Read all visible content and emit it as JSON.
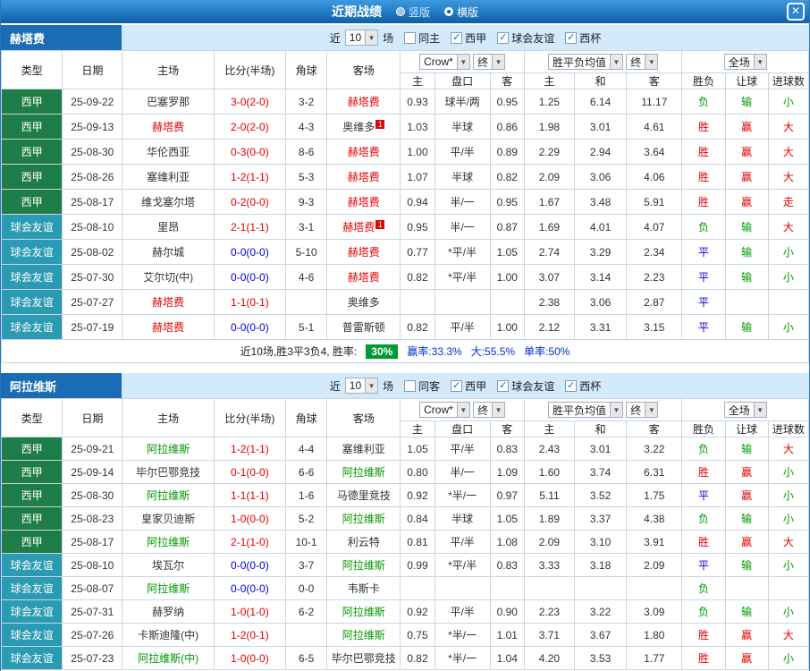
{
  "topbar": {
    "title": "近期战绩",
    "layouts": [
      {
        "label": "竖版",
        "selected": false
      },
      {
        "label": "横版",
        "selected": true
      }
    ],
    "close": "✕"
  },
  "colors": {
    "accent_blue": "#1a6cb4",
    "league_green_bg": "#1f7d48",
    "friendly_teal_bg": "#2b9bb3",
    "win_red": "#e60000",
    "loss_green": "#009900",
    "draw_blue": "#0000e0",
    "rate_badge_green": "#009933",
    "stat_blue": "#0033cc"
  },
  "table_labels": {
    "cols": [
      "类型",
      "日期",
      "主场",
      "比分(半场)",
      "角球",
      "客场"
    ],
    "book_dd": "Crow*",
    "final_dd": "终",
    "avg_dd": "胜平负均值",
    "final2_dd": "终",
    "scope_dd": "全场",
    "odds_sub": [
      "主",
      "盘口",
      "客"
    ],
    "avg_sub": [
      "主",
      "和",
      "客"
    ],
    "result_sub": [
      "胜负",
      "让球",
      "进球数"
    ]
  },
  "sections": [
    {
      "team": "赫塔费",
      "filter": {
        "recent": "近",
        "count": "10",
        "unit": "场",
        "checkboxes": [
          {
            "label": "同主",
            "checked": false
          },
          {
            "label": "西甲",
            "checked": true
          },
          {
            "label": "球会友谊",
            "checked": true
          },
          {
            "label": "西杯",
            "checked": true
          }
        ]
      },
      "rows": [
        {
          "league": "西甲",
          "lcls": "type-league",
          "date": "25-09-22",
          "home": {
            "name": "巴塞罗那",
            "cls": "",
            "badge": ""
          },
          "score": "3-0(2-0)",
          "scls": "red",
          "corners": "3-2",
          "away": {
            "name": "赫塔费",
            "cls": "t-red",
            "badge": ""
          },
          "odds": [
            "0.93",
            "球半/两",
            "0.95"
          ],
          "avg": [
            "1.25",
            "6.14",
            "11.17"
          ],
          "results": [
            [
              "负",
              "green"
            ],
            [
              "输",
              "green"
            ],
            [
              "小",
              "green"
            ]
          ]
        },
        {
          "league": "西甲",
          "lcls": "type-league",
          "date": "25-09-13",
          "home": {
            "name": "赫塔费",
            "cls": "t-red",
            "badge": ""
          },
          "score": "2-0(2-0)",
          "scls": "red",
          "corners": "4-3",
          "away": {
            "name": "奥维多",
            "cls": "",
            "badge": "1"
          },
          "odds": [
            "1.03",
            "半球",
            "0.86"
          ],
          "avg": [
            "1.98",
            "3.01",
            "4.61"
          ],
          "results": [
            [
              "胜",
              "red"
            ],
            [
              "赢",
              "red"
            ],
            [
              "大",
              "red"
            ]
          ]
        },
        {
          "league": "西甲",
          "lcls": "type-league",
          "date": "25-08-30",
          "home": {
            "name": "华伦西亚",
            "cls": "",
            "badge": ""
          },
          "score": "0-3(0-0)",
          "scls": "red",
          "corners": "8-6",
          "away": {
            "name": "赫塔费",
            "cls": "t-red",
            "badge": ""
          },
          "odds": [
            "1.00",
            "平/半",
            "0.89"
          ],
          "avg": [
            "2.29",
            "2.94",
            "3.64"
          ],
          "results": [
            [
              "胜",
              "red"
            ],
            [
              "赢",
              "red"
            ],
            [
              "大",
              "red"
            ]
          ]
        },
        {
          "league": "西甲",
          "lcls": "type-league",
          "date": "25-08-26",
          "home": {
            "name": "塞维利亚",
            "cls": "",
            "badge": ""
          },
          "score": "1-2(1-1)",
          "scls": "red",
          "corners": "5-3",
          "away": {
            "name": "赫塔费",
            "cls": "t-red",
            "badge": ""
          },
          "odds": [
            "1.07",
            "半球",
            "0.82"
          ],
          "avg": [
            "2.09",
            "3.06",
            "4.06"
          ],
          "results": [
            [
              "胜",
              "red"
            ],
            [
              "赢",
              "red"
            ],
            [
              "大",
              "red"
            ]
          ]
        },
        {
          "league": "西甲",
          "lcls": "type-league",
          "date": "25-08-17",
          "home": {
            "name": "维戈塞尔塔",
            "cls": "",
            "badge": ""
          },
          "score": "0-2(0-0)",
          "scls": "red",
          "corners": "9-3",
          "away": {
            "name": "赫塔费",
            "cls": "t-red",
            "badge": ""
          },
          "odds": [
            "0.94",
            "半/一",
            "0.95"
          ],
          "avg": [
            "1.67",
            "3.48",
            "5.91"
          ],
          "results": [
            [
              "胜",
              "red"
            ],
            [
              "赢",
              "red"
            ],
            [
              "走",
              "red"
            ]
          ]
        },
        {
          "league": "球会友谊",
          "lcls": "type-friendly",
          "date": "25-08-10",
          "home": {
            "name": "里昂",
            "cls": "",
            "badge": ""
          },
          "score": "2-1(1-1)",
          "scls": "red",
          "corners": "3-1",
          "away": {
            "name": "赫塔费",
            "cls": "t-red",
            "badge": "1"
          },
          "odds": [
            "0.95",
            "半/一",
            "0.87"
          ],
          "avg": [
            "1.69",
            "4.01",
            "4.07"
          ],
          "results": [
            [
              "负",
              "green"
            ],
            [
              "输",
              "green"
            ],
            [
              "大",
              "red"
            ]
          ]
        },
        {
          "league": "球会友谊",
          "lcls": "type-friendly",
          "date": "25-08-02",
          "home": {
            "name": "赫尔城",
            "cls": "",
            "badge": ""
          },
          "score": "0-0(0-0)",
          "scls": "blue",
          "corners": "5-10",
          "away": {
            "name": "赫塔费",
            "cls": "t-red",
            "badge": ""
          },
          "odds": [
            "0.77",
            "*平/半",
            "1.05"
          ],
          "avg": [
            "2.74",
            "3.29",
            "2.34"
          ],
          "results": [
            [
              "平",
              "blue"
            ],
            [
              "输",
              "green"
            ],
            [
              "小",
              "green"
            ]
          ]
        },
        {
          "league": "球会友谊",
          "lcls": "type-friendly",
          "date": "25-07-30",
          "home": {
            "name": "艾尔切(中)",
            "cls": "",
            "badge": ""
          },
          "score": "0-0(0-0)",
          "scls": "blue",
          "corners": "4-6",
          "away": {
            "name": "赫塔费",
            "cls": "t-red",
            "badge": ""
          },
          "odds": [
            "0.82",
            "*平/半",
            "1.00"
          ],
          "avg": [
            "3.07",
            "3.14",
            "2.23"
          ],
          "results": [
            [
              "平",
              "blue"
            ],
            [
              "输",
              "green"
            ],
            [
              "小",
              "green"
            ]
          ]
        },
        {
          "league": "球会友谊",
          "lcls": "type-friendly",
          "date": "25-07-27",
          "home": {
            "name": "赫塔费",
            "cls": "t-red",
            "badge": ""
          },
          "score": "1-1(0-1)",
          "scls": "red",
          "corners": "",
          "away": {
            "name": "奥维多",
            "cls": "",
            "badge": ""
          },
          "odds": [
            "",
            "",
            ""
          ],
          "avg": [
            "2.38",
            "3.06",
            "2.87"
          ],
          "results": [
            [
              "平",
              "blue"
            ],
            [
              "",
              ""
            ],
            [
              "",
              ""
            ]
          ]
        },
        {
          "league": "球会友谊",
          "lcls": "type-friendly",
          "date": "25-07-19",
          "home": {
            "name": "赫塔费",
            "cls": "t-red",
            "badge": ""
          },
          "score": "0-0(0-0)",
          "scls": "blue",
          "corners": "5-1",
          "away": {
            "name": "普雷斯顿",
            "cls": "",
            "badge": ""
          },
          "odds": [
            "0.82",
            "平/半",
            "1.00"
          ],
          "avg": [
            "2.12",
            "3.31",
            "3.15"
          ],
          "results": [
            [
              "平",
              "blue"
            ],
            [
              "输",
              "green"
            ],
            [
              "小",
              "green"
            ]
          ]
        }
      ],
      "summary": {
        "prefix": "近10场,胜3平3负4, 胜率:",
        "rate": "30%",
        "stats": [
          "赢率:33.3%",
          "大:55.5%",
          "单率:50%"
        ]
      }
    },
    {
      "team": "阿拉维斯",
      "filter": {
        "recent": "近",
        "count": "10",
        "unit": "场",
        "checkboxes": [
          {
            "label": "同客",
            "checked": false
          },
          {
            "label": "西甲",
            "checked": true
          },
          {
            "label": "球会友谊",
            "checked": true
          },
          {
            "label": "西杯",
            "checked": true
          }
        ]
      },
      "rows": [
        {
          "league": "西甲",
          "lcls": "type-league",
          "date": "25-09-21",
          "home": {
            "name": "阿拉维斯",
            "cls": "t-green",
            "badge": ""
          },
          "score": "1-2(1-1)",
          "scls": "red",
          "corners": "4-4",
          "away": {
            "name": "塞维利亚",
            "cls": "",
            "badge": ""
          },
          "odds": [
            "1.05",
            "平/半",
            "0.83"
          ],
          "avg": [
            "2.43",
            "3.01",
            "3.22"
          ],
          "results": [
            [
              "负",
              "green"
            ],
            [
              "输",
              "green"
            ],
            [
              "大",
              "red"
            ]
          ]
        },
        {
          "league": "西甲",
          "lcls": "type-league",
          "date": "25-09-14",
          "home": {
            "name": "毕尔巴鄂竞技",
            "cls": "",
            "badge": ""
          },
          "score": "0-1(0-0)",
          "scls": "red",
          "corners": "6-6",
          "away": {
            "name": "阿拉维斯",
            "cls": "t-green",
            "badge": ""
          },
          "odds": [
            "0.80",
            "半/一",
            "1.09"
          ],
          "avg": [
            "1.60",
            "3.74",
            "6.31"
          ],
          "results": [
            [
              "胜",
              "red"
            ],
            [
              "赢",
              "red"
            ],
            [
              "小",
              "green"
            ]
          ]
        },
        {
          "league": "西甲",
          "lcls": "type-league",
          "date": "25-08-30",
          "home": {
            "name": "阿拉维斯",
            "cls": "t-green",
            "badge": ""
          },
          "score": "1-1(1-1)",
          "scls": "red",
          "corners": "1-6",
          "away": {
            "name": "马德里竞技",
            "cls": "",
            "badge": ""
          },
          "odds": [
            "0.92",
            "*半/一",
            "0.97"
          ],
          "avg": [
            "5.11",
            "3.52",
            "1.75"
          ],
          "results": [
            [
              "平",
              "blue"
            ],
            [
              "赢",
              "red"
            ],
            [
              "小",
              "green"
            ]
          ]
        },
        {
          "league": "西甲",
          "lcls": "type-league",
          "date": "25-08-23",
          "home": {
            "name": "皇家贝迪斯",
            "cls": "",
            "badge": ""
          },
          "score": "1-0(0-0)",
          "scls": "red",
          "corners": "5-2",
          "away": {
            "name": "阿拉维斯",
            "cls": "t-green",
            "badge": ""
          },
          "odds": [
            "0.84",
            "半球",
            "1.05"
          ],
          "avg": [
            "1.89",
            "3.37",
            "4.38"
          ],
          "results": [
            [
              "负",
              "green"
            ],
            [
              "输",
              "green"
            ],
            [
              "小",
              "green"
            ]
          ]
        },
        {
          "league": "西甲",
          "lcls": "type-league",
          "date": "25-08-17",
          "home": {
            "name": "阿拉维斯",
            "cls": "t-green",
            "badge": ""
          },
          "score": "2-1(1-0)",
          "scls": "red",
          "corners": "10-1",
          "away": {
            "name": "利云特",
            "cls": "",
            "badge": ""
          },
          "odds": [
            "0.81",
            "平/半",
            "1.08"
          ],
          "avg": [
            "2.09",
            "3.10",
            "3.91"
          ],
          "results": [
            [
              "胜",
              "red"
            ],
            [
              "赢",
              "red"
            ],
            [
              "大",
              "red"
            ]
          ]
        },
        {
          "league": "球会友谊",
          "lcls": "type-friendly",
          "date": "25-08-10",
          "home": {
            "name": "埃瓦尔",
            "cls": "",
            "badge": ""
          },
          "score": "0-0(0-0)",
          "scls": "blue",
          "corners": "3-7",
          "away": {
            "name": "阿拉维斯",
            "cls": "t-green",
            "badge": ""
          },
          "odds": [
            "0.99",
            "*平/半",
            "0.83"
          ],
          "avg": [
            "3.33",
            "3.18",
            "2.09"
          ],
          "results": [
            [
              "平",
              "blue"
            ],
            [
              "输",
              "green"
            ],
            [
              "小",
              "green"
            ]
          ]
        },
        {
          "league": "球会友谊",
          "lcls": "type-friendly",
          "date": "25-08-07",
          "home": {
            "name": "阿拉维斯",
            "cls": "t-green",
            "badge": ""
          },
          "score": "0-0(0-0)",
          "scls": "blue",
          "corners": "0-0",
          "away": {
            "name": "韦斯卡",
            "cls": "",
            "badge": ""
          },
          "odds": [
            "",
            "",
            ""
          ],
          "avg": [
            "",
            "",
            ""
          ],
          "results": [
            [
              "负",
              "green"
            ],
            [
              "",
              ""
            ],
            [
              "",
              ""
            ]
          ]
        },
        {
          "league": "球会友谊",
          "lcls": "type-friendly",
          "date": "25-07-31",
          "home": {
            "name": "赫罗纳",
            "cls": "",
            "badge": ""
          },
          "score": "1-0(1-0)",
          "scls": "red",
          "corners": "6-2",
          "away": {
            "name": "阿拉维斯",
            "cls": "t-green",
            "badge": ""
          },
          "odds": [
            "0.92",
            "平/半",
            "0.90"
          ],
          "avg": [
            "2.23",
            "3.22",
            "3.09"
          ],
          "results": [
            [
              "负",
              "green"
            ],
            [
              "输",
              "green"
            ],
            [
              "小",
              "green"
            ]
          ]
        },
        {
          "league": "球会友谊",
          "lcls": "type-friendly",
          "date": "25-07-26",
          "home": {
            "name": "卡斯迪隆(中)",
            "cls": "",
            "badge": ""
          },
          "score": "1-2(0-1)",
          "scls": "red",
          "corners": "",
          "away": {
            "name": "阿拉维斯",
            "cls": "t-green",
            "badge": ""
          },
          "odds": [
            "0.75",
            "*半/一",
            "1.01"
          ],
          "avg": [
            "3.71",
            "3.67",
            "1.80"
          ],
          "results": [
            [
              "胜",
              "red"
            ],
            [
              "赢",
              "red"
            ],
            [
              "大",
              "red"
            ]
          ]
        },
        {
          "league": "球会友谊",
          "lcls": "type-friendly",
          "date": "25-07-23",
          "home": {
            "name": "阿拉维斯(中)",
            "cls": "t-green",
            "badge": ""
          },
          "score": "1-0(0-0)",
          "scls": "red",
          "corners": "6-5",
          "away": {
            "name": "毕尔巴鄂竞技",
            "cls": "",
            "badge": ""
          },
          "odds": [
            "0.82",
            "*半/一",
            "1.04"
          ],
          "avg": [
            "4.20",
            "3.53",
            "1.77"
          ],
          "results": [
            [
              "胜",
              "red"
            ],
            [
              "赢",
              "red"
            ],
            [
              "小",
              "green"
            ]
          ]
        }
      ]
    }
  ]
}
